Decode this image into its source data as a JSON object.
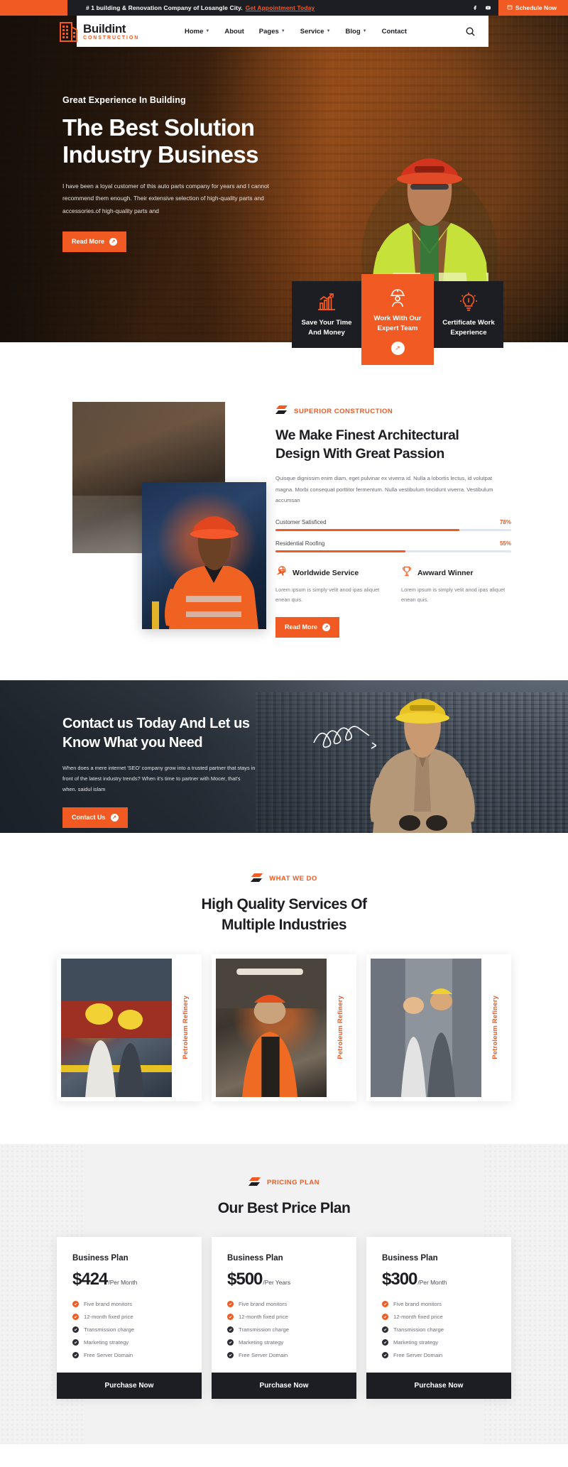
{
  "topbar": {
    "message": "# 1 building & Renovation Company of Losangle City.",
    "link": "Get Appointment Today",
    "social": [
      "facebook-icon",
      "youtube-icon"
    ],
    "cta": "Schedule Now"
  },
  "header": {
    "logo_name": "Buildint",
    "logo_sub": "CONSTRUCTION",
    "nav": [
      {
        "label": "Home",
        "has_dropdown": true
      },
      {
        "label": "About",
        "has_dropdown": false
      },
      {
        "label": "Pages",
        "has_dropdown": true
      },
      {
        "label": "Service",
        "has_dropdown": true
      },
      {
        "label": "Blog",
        "has_dropdown": true
      },
      {
        "label": "Contact",
        "has_dropdown": false
      }
    ],
    "search_icon": "search-icon"
  },
  "hero": {
    "eyebrow": "Great Experience In Building",
    "title_line1": "The Best Solution",
    "title_line2": "Industry Business",
    "description": "I have been a loyal customer of this auto parts company for years and I cannot recommend them enough. Their extensive selection of high-quality parts and accessories.of high-quality parts and",
    "button": "Read More"
  },
  "features": [
    {
      "icon": "growth-chart-icon",
      "line1": "Save Your Time",
      "line2": "And Money",
      "highlight": false
    },
    {
      "icon": "worker-helmet-icon",
      "line1": "Work With Our",
      "line2": "Expert Team",
      "highlight": true
    },
    {
      "icon": "lightbulb-icon",
      "line1": "Certificate Work",
      "line2": "Experience",
      "highlight": false
    }
  ],
  "about": {
    "eyebrow": "SUPERIOR CONSTRUCTION",
    "title_line1": "We Make Finest Architectural",
    "title_line2": "Design With Great Passion",
    "description": "Quisque dignissim enim diam, eget pulvinar ex viverra id. Nulla a lobortis lectus, id volutpat magna. Morbi consequat porttitor fermentum. Nulla vestibulum tincidunt viverra. Vestibulum accumsan",
    "skills": [
      {
        "name": "Customer Satisficed",
        "percent": "78%",
        "value": 78
      },
      {
        "name": "Residential Roofing",
        "percent": "55%",
        "value": 55
      }
    ],
    "feats": [
      {
        "icon": "globe-plane-icon",
        "title": "Worldwide Service",
        "text": "Lorem ipsum is simply velit anod ipas aliquet enean quis."
      },
      {
        "icon": "trophy-icon",
        "title": "Awward Winner",
        "text": "Lorem ipsum is simply velit anod ipas aliquet enean quis."
      }
    ],
    "button": "Read More"
  },
  "cta": {
    "title_line1": "Contact us Today And Let us",
    "title_line2": "Know What you Need",
    "description": "When does a mere internet 'SEO' company grow into a trusted partner that stays in front of the latest industry trends? When it's time to partner with Mocer, that's when. saidul islam",
    "button": "Contact Us"
  },
  "services": {
    "eyebrow": "WHAT WE DO",
    "title_line1": "High Quality Services Of",
    "title_line2": "Multiple Industries",
    "cards": [
      {
        "label": "Petroleum Refinery"
      },
      {
        "label": "Petroleum Refinery"
      },
      {
        "label": "Petroleum Refinery"
      }
    ]
  },
  "pricing": {
    "eyebrow": "PRICING PLAN",
    "title": "Our Best Price Plan",
    "plans": [
      {
        "name": "Business Plan",
        "price": "$424",
        "period": "/Per Month",
        "features": [
          {
            "text": "Five brand monitors",
            "active": true
          },
          {
            "text": "12-month fixed price",
            "active": true
          },
          {
            "text": "Transmission charge",
            "active": false
          },
          {
            "text": "Marketing strategy",
            "active": false
          },
          {
            "text": "Free Server Domain",
            "active": false
          }
        ],
        "button": "Purchase Now"
      },
      {
        "name": "Business Plan",
        "price": "$500",
        "period": "/Per Years",
        "features": [
          {
            "text": "Five brand monitors",
            "active": true
          },
          {
            "text": "12-month fixed price",
            "active": true
          },
          {
            "text": "Transmission charge",
            "active": false
          },
          {
            "text": "Marketing strategy",
            "active": false
          },
          {
            "text": "Free Server Domain",
            "active": false
          }
        ],
        "button": "Purchase Now"
      },
      {
        "name": "Business Plan",
        "price": "$300",
        "period": "/Per Month",
        "features": [
          {
            "text": "Five brand monitors",
            "active": true
          },
          {
            "text": "12-month fixed price",
            "active": true
          },
          {
            "text": "Transmission charge",
            "active": false
          },
          {
            "text": "Marketing strategy",
            "active": false
          },
          {
            "text": "Free Server Domain",
            "active": false
          }
        ],
        "button": "Purchase Now"
      }
    ]
  },
  "colors": {
    "accent": "#f15a22",
    "dark": "#1d1d24",
    "muted": "#6e6e78"
  }
}
